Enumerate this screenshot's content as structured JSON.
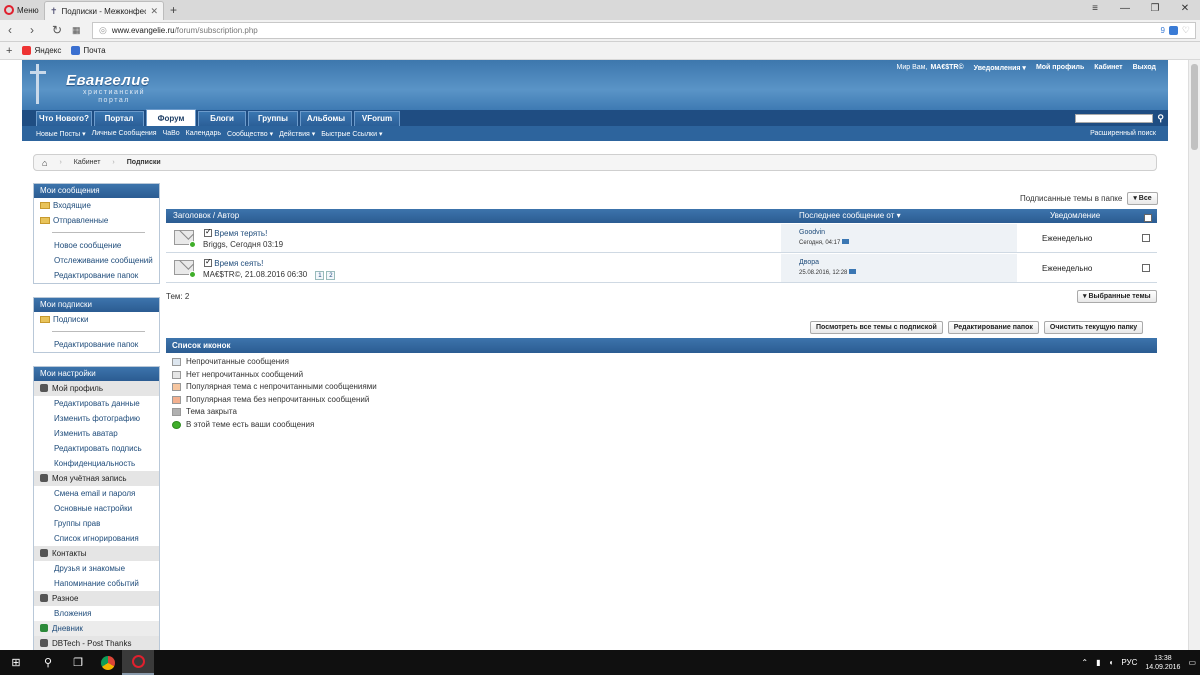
{
  "browser": {
    "menu_label": "Меню",
    "tab_title": "Подписки - Межконфесс",
    "url_domain": "www.evangelie.ru",
    "url_path": "/forum/subscription.php",
    "badge_count": "9",
    "bookmarks": [
      {
        "label": "Яндекс",
        "color": "#e33"
      },
      {
        "label": "Почта",
        "color": "#3a6fd0"
      }
    ]
  },
  "site": {
    "logo_name": "Евангелие",
    "logo_sub1": "христианский",
    "logo_sub2": "портал",
    "top_links": {
      "hello": "Мир Вам,",
      "user": "MA€$TR©",
      "notifications": "Уведомления ▾",
      "profile": "Мой профиль",
      "cabinet": "Кабинет",
      "logout": "Выход"
    },
    "tabs": [
      {
        "label": "Что Нового?",
        "active": false
      },
      {
        "label": "Портал",
        "active": false
      },
      {
        "label": "Форум",
        "active": true
      },
      {
        "label": "Блоги",
        "active": false
      },
      {
        "label": "Группы",
        "active": false
      },
      {
        "label": "Альбомы",
        "active": false
      },
      {
        "label": "VForum",
        "active": false
      }
    ],
    "subnav": [
      "Новые Посты ▾",
      "Личные Сообщения",
      "ЧаВо",
      "Календарь",
      "Сообщество ▾",
      "Действия ▾",
      "Быстрые Ссылки ▾"
    ],
    "advanced_search": "Расширенный поиск"
  },
  "breadcrumb": {
    "items": [
      "Кабинет",
      "Подписки"
    ]
  },
  "sidebar": {
    "messages": {
      "title": "Мои сообщения",
      "folders": [
        "Входящие",
        "Отправленные"
      ],
      "links": [
        "Новое сообщение",
        "Отслеживание сообщений",
        "Редактирование папок"
      ]
    },
    "subscriptions": {
      "title": "Мои подписки",
      "folders": [
        "Подписки"
      ],
      "links": [
        "Редактирование папок"
      ]
    },
    "settings": {
      "title": "Мои настройки",
      "sections": [
        {
          "title": "Мой профиль",
          "items": [
            "Редактировать данные",
            "Изменить фотографию",
            "Изменить аватар",
            "Редактировать подпись",
            "Конфиденциальность"
          ]
        },
        {
          "title": "Моя учётная запись",
          "items": [
            "Смена email и пароля",
            "Основные настройки",
            "Группы прав",
            "Список игнорирования"
          ]
        },
        {
          "title": "Контакты",
          "items": [
            "Друзья и знакомые",
            "Напоминание событий"
          ]
        },
        {
          "title": "Разное",
          "items": [
            "Вложения"
          ]
        }
      ],
      "diary": "Дневник",
      "dbtech": "DBTech - Post Thanks"
    }
  },
  "main": {
    "folder_label": "Подписанные темы в папке",
    "folder_value": "▾ Все",
    "columns": {
      "title_author": "Заголовок / Автор",
      "last_post": "Последнее сообщение от ▾",
      "notify": "Уведомление"
    },
    "threads": [
      {
        "title": "Время терять!",
        "meta": "Briggs, Сегодня 03:19",
        "pages": [],
        "last_user": "Goodvin",
        "last_date": "Сегодня, 04:17",
        "notify": "Еженедельно"
      },
      {
        "title": "Время сеять!",
        "meta": "MA€$TR©, 21.08.2016 06:30",
        "pages": [
          "1",
          "2"
        ],
        "last_user": "Двора",
        "last_date": "25.08.2016, 12:28",
        "notify": "Еженедельно"
      }
    ],
    "count": "Тем: 2",
    "selected_btn": "▾ Выбранные темы",
    "action_buttons": [
      "Посмотреть все темы с подпиской",
      "Редактирование папок",
      "Очистить текущую папку"
    ],
    "legend_title": "Список иконок",
    "legend": [
      {
        "label": "Непрочитанные сообщения",
        "color": "#dde6ef"
      },
      {
        "label": "Нет непрочитанных сообщений",
        "color": "#e6e6e6"
      },
      {
        "label": "Популярная тема с непрочитанными сообщениями",
        "color": "#f6c6a0"
      },
      {
        "label": "Популярная тема без непрочитанных сообщений",
        "color": "#f3b08f"
      },
      {
        "label": "Тема закрыта",
        "color": "#b0b0b0"
      },
      {
        "label": "В этой теме есть ваши сообщения",
        "color": "#3fae2a"
      }
    ]
  },
  "taskbar": {
    "lang": "РУС",
    "time": "13:38",
    "date": "14.09.2016"
  }
}
